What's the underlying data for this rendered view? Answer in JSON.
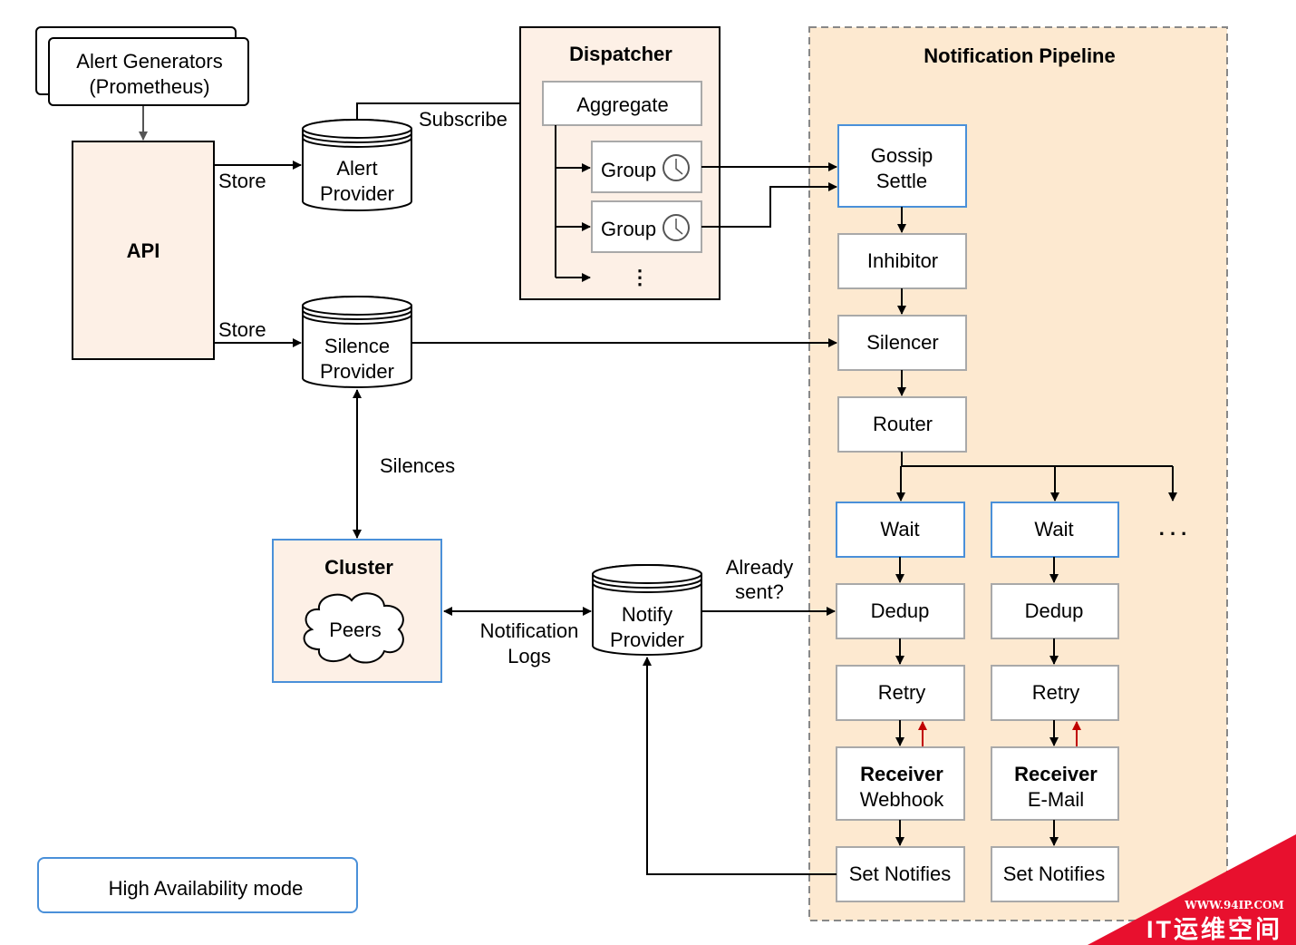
{
  "alert_generators": {
    "line1": "Alert Generators",
    "line2": "(Prometheus)"
  },
  "api": {
    "label": "API"
  },
  "edges": {
    "store_alerts": "Store",
    "store_silences": "Store",
    "subscribe": "Subscribe",
    "silences": "Silences",
    "notification_logs": {
      "line1": "Notification",
      "line2": "Logs"
    },
    "already_sent": {
      "line1": "Already",
      "line2": "sent?"
    }
  },
  "alert_provider": {
    "line1": "Alert",
    "line2": "Provider"
  },
  "silence_provider": {
    "line1": "Silence",
    "line2": "Provider"
  },
  "notify_provider": {
    "line1": "Notify",
    "line2": "Provider"
  },
  "dispatcher": {
    "title": "Dispatcher",
    "aggregate": "Aggregate",
    "groups": [
      "Group",
      "Group"
    ],
    "more": "⋮",
    "group_icon": "clock-icon"
  },
  "cluster": {
    "title": "Cluster",
    "peers": "Peers"
  },
  "pipeline": {
    "title": "Notification Pipeline",
    "gossip": {
      "line1": "Gossip",
      "line2": "Settle"
    },
    "inhibitor": "Inhibitor",
    "silencer": "Silencer",
    "router": "Router",
    "more": ". . .",
    "branches": [
      {
        "wait": "Wait",
        "dedup": "Dedup",
        "retry": "Retry",
        "receiver_title": "Receiver",
        "receiver_name": "Webhook",
        "set_notifies": "Set Notifies"
      },
      {
        "wait": "Wait",
        "dedup": "Dedup",
        "retry": "Retry",
        "receiver_title": "Receiver",
        "receiver_name": "E-Mail",
        "set_notifies": "Set Notifies"
      }
    ]
  },
  "legend": {
    "ha_mode": "High Availability mode"
  },
  "watermark": {
    "url": "WWW.94IP.COM",
    "name": "IT运维空间"
  },
  "colors": {
    "panel": "#fdf0e6",
    "pipeline": "#fde9d0",
    "highlight": "#4a90d9",
    "retry_arrow": "#c00000",
    "watermark": "#e8102e"
  }
}
